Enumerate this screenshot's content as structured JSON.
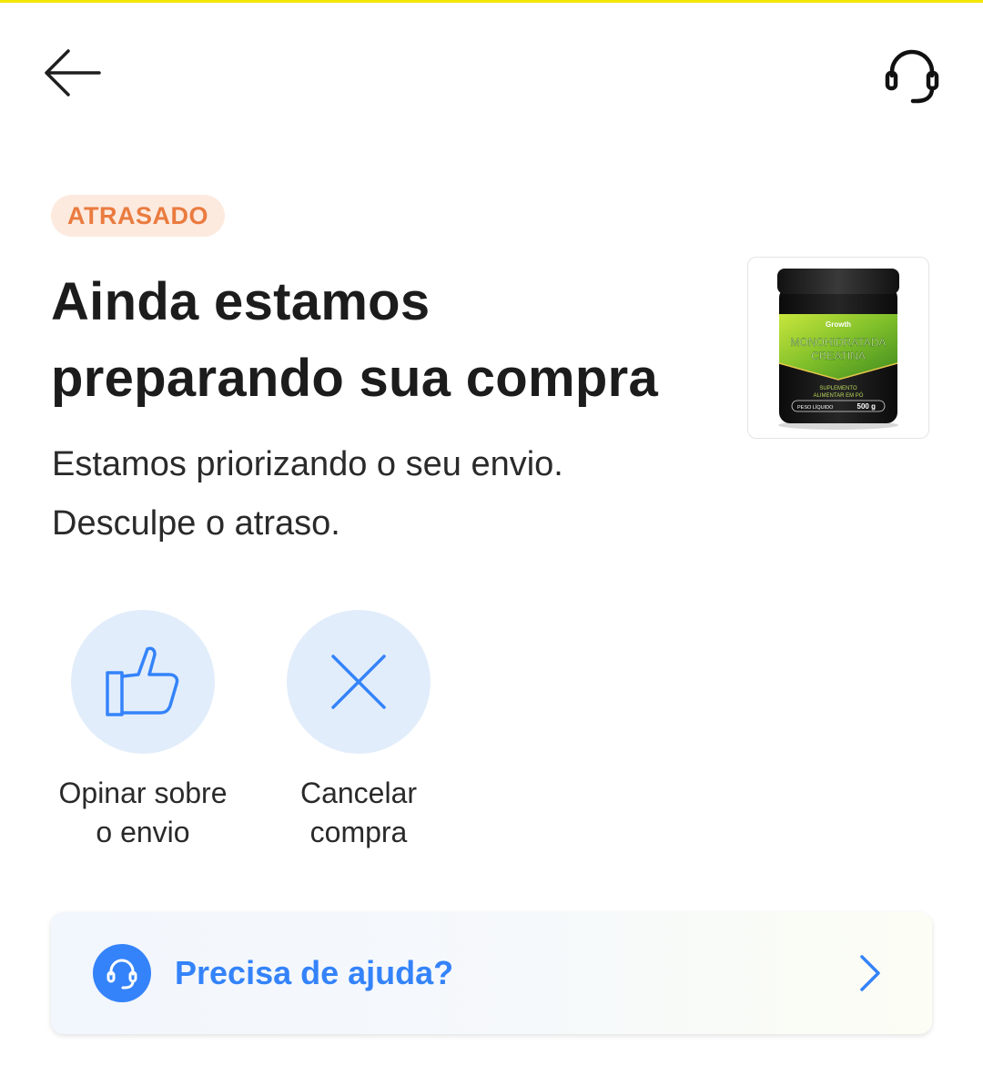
{
  "header": {
    "back_icon": "arrow-left-icon",
    "support_icon": "headset-icon"
  },
  "status": {
    "badge": "ATRASADO",
    "badge_text_color": "#ea7b3f",
    "badge_bg_color": "#fdeadf"
  },
  "main": {
    "title_line1": "Ainda estamos",
    "title_line2": "preparando sua compra",
    "subtitle_line1": "Estamos priorizando o seu envio.",
    "subtitle_line2": "Desculpe o atraso."
  },
  "product": {
    "brand": "Growth",
    "name_line1": "MONOHIDRATADA",
    "name_line2": "CREATINA",
    "desc_line1": "SUPLEMENTO",
    "desc_line2": "ALIMENTAR EM PÓ",
    "weight_label": "PESO LÍQUIDO",
    "weight_value": "500 g"
  },
  "actions": [
    {
      "icon": "thumbs-up-icon",
      "label_line1": "Opinar sobre",
      "label_line2": "o envio"
    },
    {
      "icon": "close-icon",
      "label_line1": "Cancelar",
      "label_line2": "compra"
    }
  ],
  "help": {
    "icon": "headset-icon",
    "label": "Precisa de ajuda?",
    "chevron_icon": "chevron-right-icon"
  },
  "colors": {
    "accent": "#3483fa",
    "action_circle_bg": "#e2edfb",
    "top_strip": "#f3e600"
  }
}
